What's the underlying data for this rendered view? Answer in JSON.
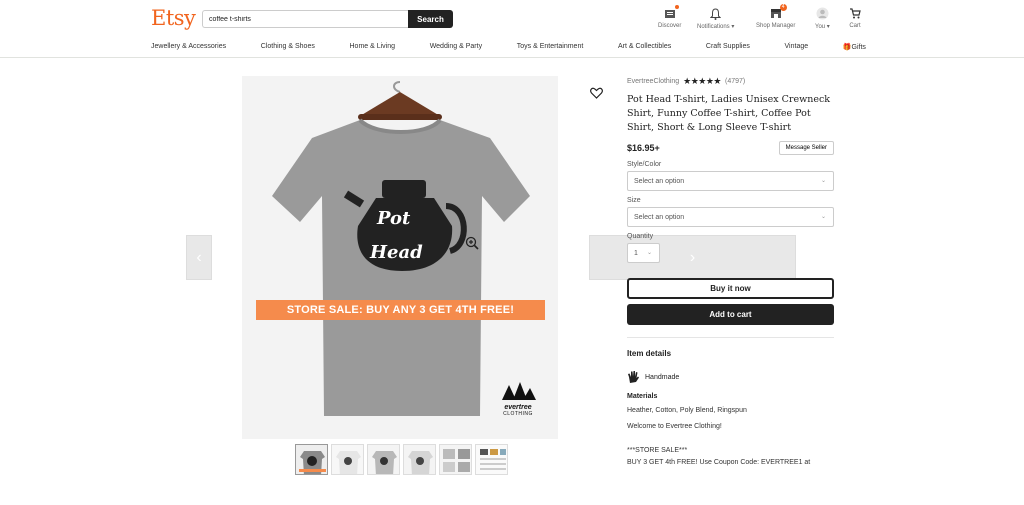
{
  "header": {
    "logo": "Etsy",
    "search_value": "coffee t-shirts",
    "search_button": "Search",
    "nav": {
      "discover": "Discover",
      "notifications": "Notifications",
      "shop_manager": "Shop Manager",
      "you": "You",
      "cart": "Cart",
      "shop_manager_badge": "4"
    },
    "categories": [
      "Jewellery & Accessories",
      "Clothing & Shoes",
      "Home & Living",
      "Wedding & Party",
      "Toys & Entertainment",
      "Art & Collectibles",
      "Craft Supplies",
      "Vintage",
      "Gifts"
    ]
  },
  "gallery": {
    "sale_banner": "STORE SALE: BUY ANY 3 GET 4TH FREE!",
    "shirt_text_1": "Pot",
    "shirt_text_2": "Head",
    "brand_mark_1": "evertree",
    "brand_mark_2": "CLOTHING",
    "thumbnails": 6,
    "icons": [
      "chevron-left-icon",
      "chevron-right-icon",
      "zoom-icon",
      "heart-icon"
    ]
  },
  "product": {
    "shop_name": "EvertreeClothing",
    "stars": "★★★★★",
    "rating": 5,
    "review_count": "(4797)",
    "title": "Pot Head T-shirt, Ladies Unisex Crewneck Shirt, Funny Coffee T-shirt, Coffee Pot Shirt, Short & Long Sleeve T-shirt",
    "price": "$16.95+",
    "message_seller": "Message Seller",
    "style_label": "Style/Color",
    "style_placeholder": "Select an option",
    "size_label": "Size",
    "size_placeholder": "Select an option",
    "quantity_label": "Quantity",
    "quantity_value": "1",
    "buy_now": "Buy it now",
    "add_to_cart": "Add to cart",
    "item_details": "Item details",
    "handmade": "Handmade",
    "materials_label": "Materials",
    "materials": "Heather, Cotton, Poly Blend, Ringspun",
    "desc_1": "Welcome to Evertree Clothing!",
    "desc_2": "***STORE SALE***",
    "desc_3": "BUY 3 GET 4th FREE! Use Coupon Code: EVERTREE1 at"
  },
  "colors": {
    "brand": "#f1641e",
    "sale_banner": "#f58b4c",
    "dark": "#222222"
  }
}
